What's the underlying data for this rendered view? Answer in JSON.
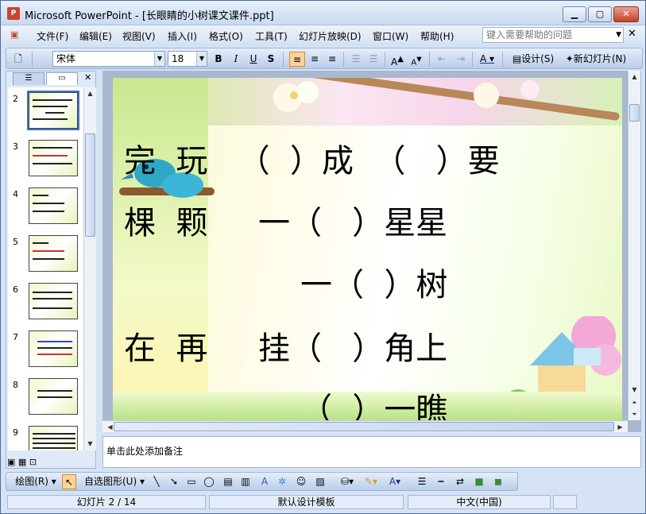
{
  "window": {
    "title": "Microsoft PowerPoint - [长眼睛的小树课文课件.ppt]",
    "minimize_icon": "minimize-icon",
    "restore_icon": "restore-icon",
    "close_icon": "close-icon"
  },
  "menu": {
    "items": [
      "文件(F)",
      "编辑(E)",
      "视图(V)",
      "插入(I)",
      "格式(O)",
      "工具(T)",
      "幻灯片放映(D)",
      "窗口(W)",
      "帮助(H)"
    ],
    "help_placeholder": "键入需要帮助的问题"
  },
  "toolbar": {
    "font_name": "宋体",
    "font_size": "18",
    "bold": "B",
    "italic": "I",
    "underline": "U",
    "shadow": "S",
    "design_label": "设计(S)",
    "new_slide_label": "新幻灯片(N)"
  },
  "slides_panel": {
    "numbers": [
      "2",
      "3",
      "4",
      "5",
      "6",
      "7",
      "8",
      "9"
    ],
    "selected": "2"
  },
  "slide": {
    "lines": [
      "完  玩   （  ）成  （   ）要",
      "棵  颗     一（   ）星星",
      "一（  ）树",
      "在  再     挂（   ）角上",
      "（  ）一瞧"
    ]
  },
  "notes": {
    "placeholder": "单击此处添加备注"
  },
  "drawing_toolbar": {
    "draw_label": "绘图(R)",
    "autoshapes_label": "自选图形(U)"
  },
  "status": {
    "slide_position": "幻灯片 2 / 14",
    "template": "默认设计模板",
    "language": "中文(中国)"
  }
}
